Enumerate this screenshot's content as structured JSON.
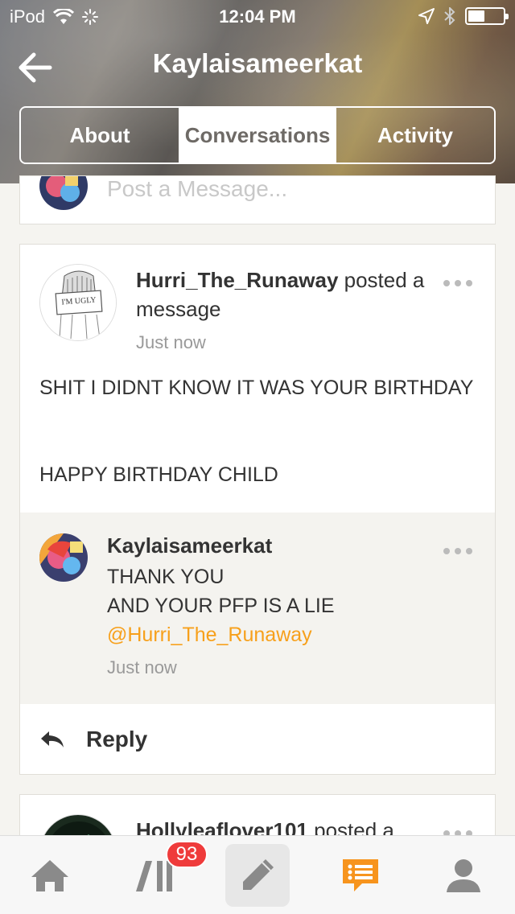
{
  "status_bar": {
    "carrier": "iPod",
    "time": "12:04 PM"
  },
  "nav": {
    "title": "Kaylaisameerkat",
    "icons": {
      "back": "back-arrow-icon"
    }
  },
  "tabs": [
    {
      "label": "About",
      "active": false
    },
    {
      "label": "Conversations",
      "active": true
    },
    {
      "label": "Activity",
      "active": false
    }
  ],
  "post_box": {
    "placeholder": "Post a Message..."
  },
  "message": {
    "author": "Hurri_The_Runaway",
    "action": " posted a message",
    "time": "Just now",
    "avatar_text": "I'M UGLY",
    "body_line1": "SHIT I DIDNT KNOW IT WAS YOUR BIRTHDAY",
    "body_line2": "HAPPY BIRTHDAY CHILD",
    "reply": {
      "author": "Kaylaisameerkat",
      "line1": "THANK YOU",
      "line2": "AND YOUR PFP IS A LIE",
      "mention": "@Hurri_The_Runaway",
      "time": "Just now"
    },
    "reply_button": "Reply"
  },
  "next_message": {
    "author": "Hollyleaflover101",
    "action": " posted a"
  },
  "tabbar": {
    "badge": "93",
    "items": [
      "home-icon",
      "activity-feed-icon",
      "compose-pencil-icon",
      "messages-icon",
      "profile-icon"
    ],
    "active_color": "#f7941d"
  },
  "colors": {
    "accent": "#f7a01b",
    "badge": "#ef3b3b"
  }
}
